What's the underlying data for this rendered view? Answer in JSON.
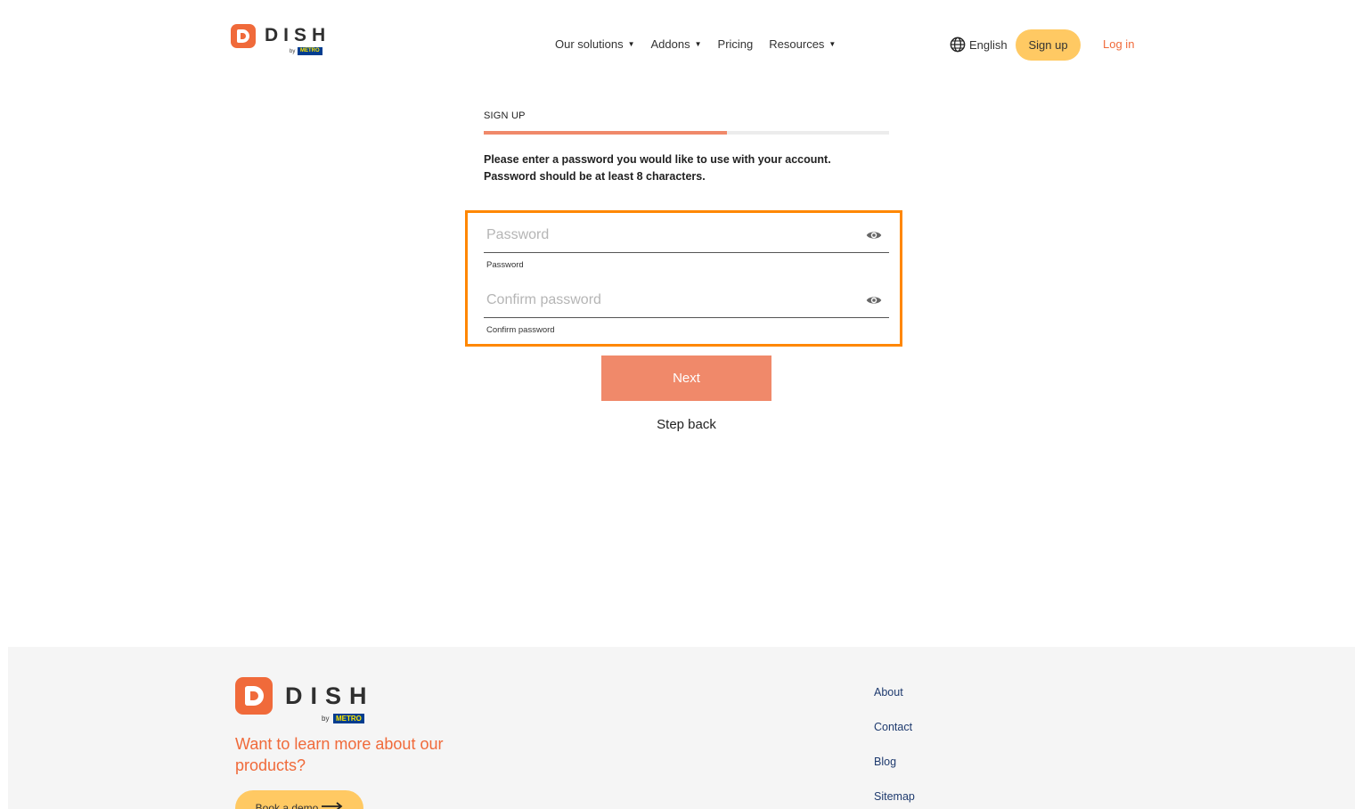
{
  "brand": {
    "name": "DISH",
    "by": "by",
    "parent": "METRO"
  },
  "nav": {
    "items": [
      {
        "label": "Our solutions",
        "caret": "▼"
      },
      {
        "label": "Addons",
        "caret": "▼"
      },
      {
        "label": "Pricing",
        "caret": ""
      },
      {
        "label": "Resources",
        "caret": "▼"
      }
    ],
    "language": "English",
    "signup_label": "Sign up",
    "login_label": "Log in"
  },
  "form": {
    "step_label": "SIGN UP",
    "progress_fraction": 0.6,
    "instructions": "Please enter a password you would like to use with your account. Password should be at least 8 characters.",
    "password": {
      "placeholder": "Password",
      "value": "",
      "helper": "Password"
    },
    "confirm": {
      "placeholder": "Confirm password",
      "value": "",
      "helper": "Confirm password"
    },
    "next_label": "Next",
    "step_back_label": "Step back"
  },
  "footer": {
    "tagline": "Want to learn more about our products?",
    "demo_label": "Book a demo",
    "links": [
      "About",
      "Contact",
      "Blog",
      "Sitemap"
    ]
  },
  "colors": {
    "brand_orange": "#f06a3a",
    "button_salmon": "#f0896a",
    "signup_yellow": "#ffc963",
    "highlight": "#ff8700"
  }
}
